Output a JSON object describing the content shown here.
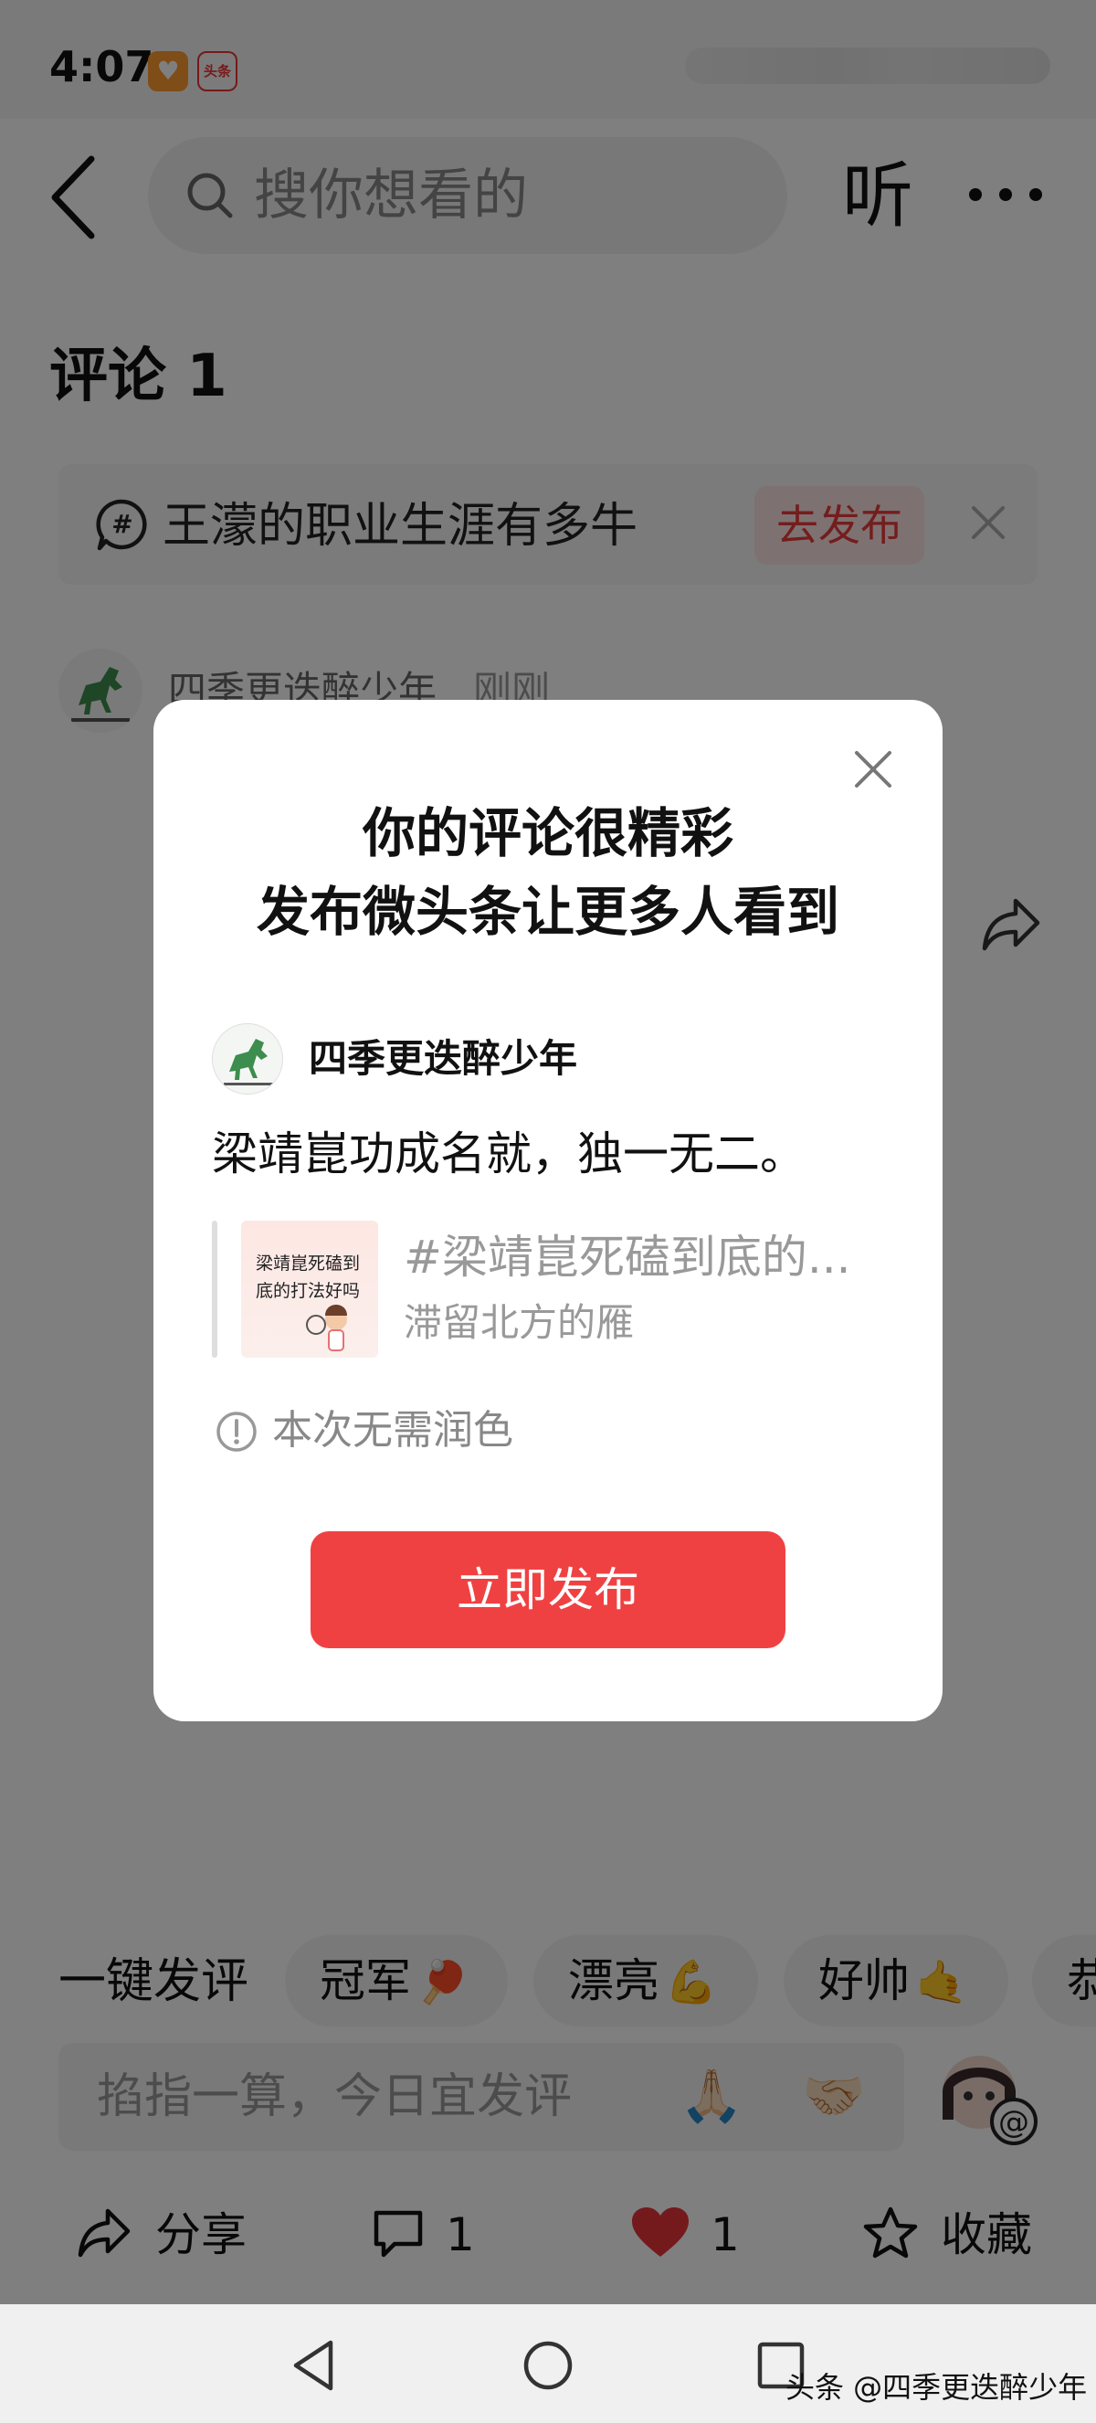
{
  "status_bar": {
    "time": "4:07",
    "app_badge_1": "♥",
    "app_badge_2": "头条"
  },
  "top_bar": {
    "search_placeholder": "搜你想看的",
    "listen_label": "听"
  },
  "comments": {
    "title": "评论 1",
    "topic": {
      "text": "王濛的职业生涯有多牛",
      "publish_label": "去发布"
    },
    "first": {
      "user": "四季更迭醉少年",
      "time": "刚刚"
    }
  },
  "quick_reply": {
    "label": "一键发评",
    "chips": [
      {
        "text": "冠军",
        "emoji": "🏓"
      },
      {
        "text": "漂亮",
        "emoji": "💪"
      },
      {
        "text": "好帅",
        "emoji": "🤙"
      },
      {
        "text": "恭",
        "emoji": ""
      }
    ]
  },
  "reply_input": {
    "placeholder": "掐指一算，今日宜发评",
    "emoji_1": "🙏🏻",
    "emoji_2": "🤝🏻"
  },
  "action_bar": {
    "share_label": "分享",
    "comment_count": "1",
    "like_count": "1",
    "favorite_label": "收藏"
  },
  "watermark": "头条 @四季更迭醉少年",
  "dialog": {
    "title_line1": "你的评论很精彩",
    "title_line2": "发布微头条让更多人看到",
    "author_name": "四季更迭醉少年",
    "body_text": "梁靖崑功成名就，独一无二。",
    "quote": {
      "thumb_text": "梁靖崑死磕到底的打法好吗",
      "title": "#梁靖崑死磕到底的...",
      "author": "滞留北方的雁"
    },
    "note": "本次无需润色",
    "button_label": "立即发布"
  },
  "colors": {
    "accent_red": "#f04142",
    "overlay": "rgba(0,0,0,0.5)",
    "like_red": "#e8343a"
  },
  "icons": [
    "back-icon",
    "search-icon",
    "more-icon",
    "topic-icon",
    "close-icon",
    "share-icon",
    "comment-icon",
    "heart-icon",
    "star-icon",
    "info-icon",
    "nav-back-icon",
    "nav-home-icon",
    "nav-recents-icon"
  ]
}
